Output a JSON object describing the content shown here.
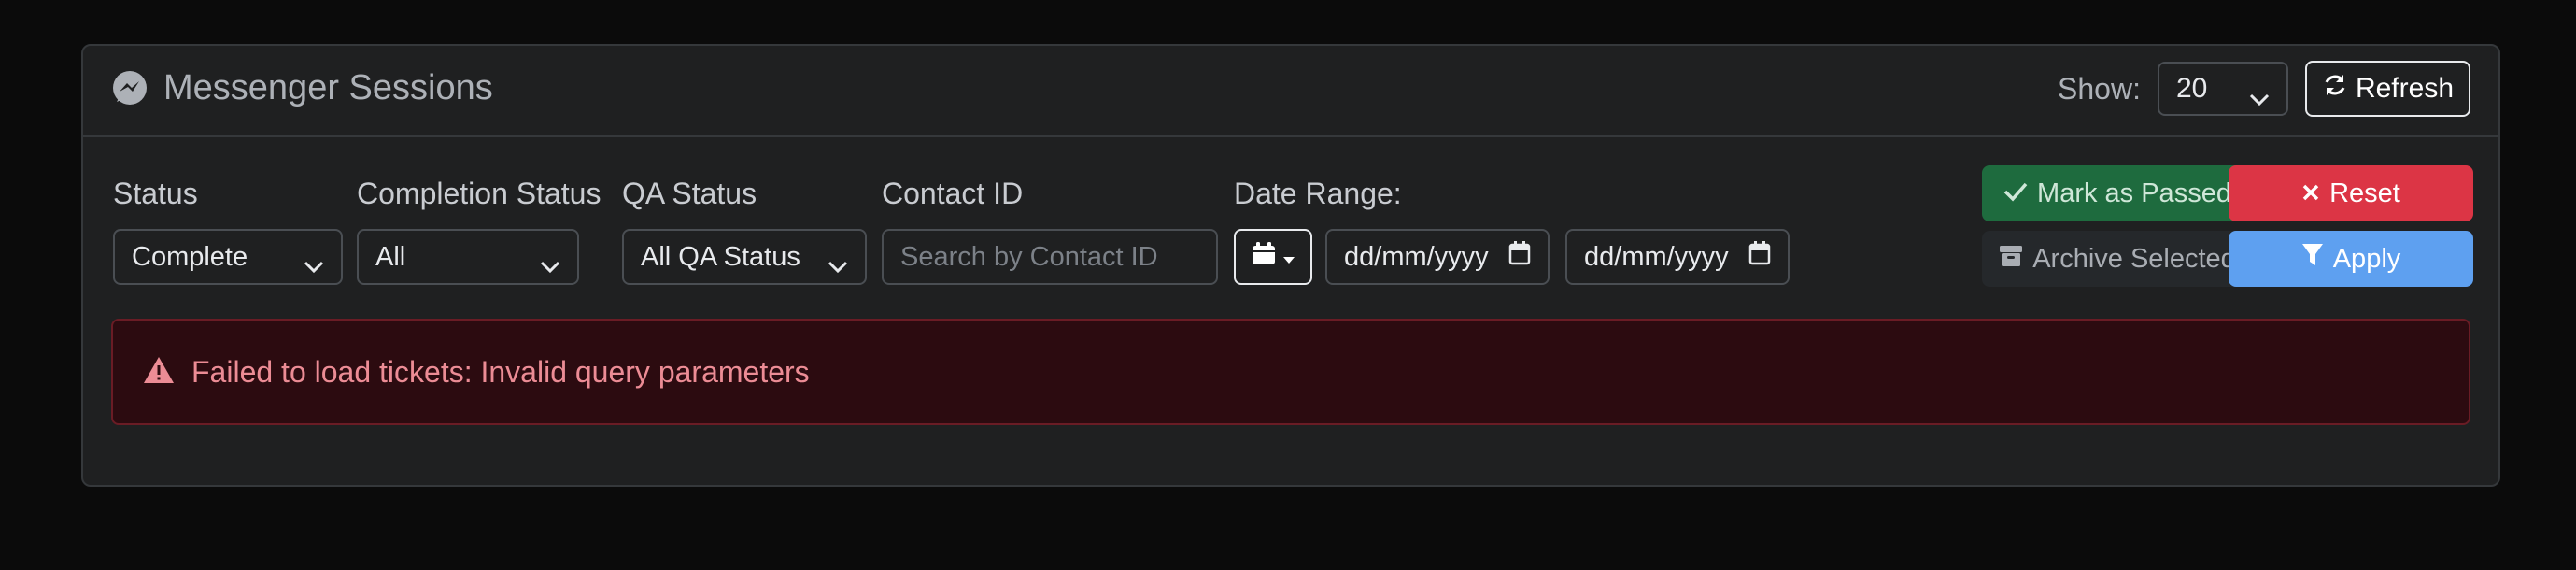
{
  "header": {
    "title": "Messenger Sessions",
    "show_label": "Show:",
    "show_value": "20",
    "refresh_label": "Refresh"
  },
  "filters": {
    "status": {
      "label": "Status",
      "value": "Complete"
    },
    "completion_status": {
      "label": "Completion Status",
      "value": "All"
    },
    "qa_status": {
      "label": "QA Status",
      "value": "All QA Status"
    },
    "contact_id": {
      "label": "Contact ID",
      "placeholder": "Search by Contact ID"
    },
    "date_range": {
      "label": "Date Range:",
      "from_placeholder": "dd/mm/yyyy",
      "to_placeholder": "dd/mm/yyyy"
    }
  },
  "actions": {
    "mark_passed": "Mark as Passed",
    "reset": "Reset",
    "archive": "Archive Selected",
    "apply": "Apply"
  },
  "alert": {
    "message": "Failed to load tickets: Invalid query parameters"
  },
  "colors": {
    "background": "#0b0b0b",
    "card": "#1f2021",
    "success": "#1e6b3e",
    "danger": "#dc3545",
    "primary": "#5ea0f0",
    "alert_bg": "#2c0b10",
    "alert_text": "#ec8c95"
  },
  "icons": {
    "header": "messenger-icon",
    "refresh": "refresh-icon",
    "date": "calendar-icon",
    "mark_passed": "check-icon",
    "reset": "x-icon",
    "archive": "archive-icon",
    "apply": "filter-icon",
    "alert": "warning-icon"
  }
}
